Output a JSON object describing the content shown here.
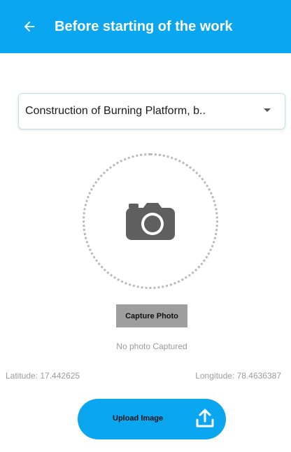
{
  "toolbar": {
    "title": "Before starting of the work",
    "back_icon": "arrow-left-icon",
    "background": "#0aa6f0"
  },
  "work_select": {
    "selected_value": "Construction of Burning Platform, b..",
    "caret_icon": "caret-down-icon"
  },
  "photo": {
    "placeholder_icon": "camera-icon",
    "capture_label": "Capture Photo",
    "status": "No photo Captured"
  },
  "location": {
    "latitude_text": "Latitude: 17.442625",
    "longitude_text": "Longitude: 78.4636387"
  },
  "upload": {
    "label": "Upload Image",
    "icon": "upload-icon",
    "color": "#0aa6f0"
  }
}
